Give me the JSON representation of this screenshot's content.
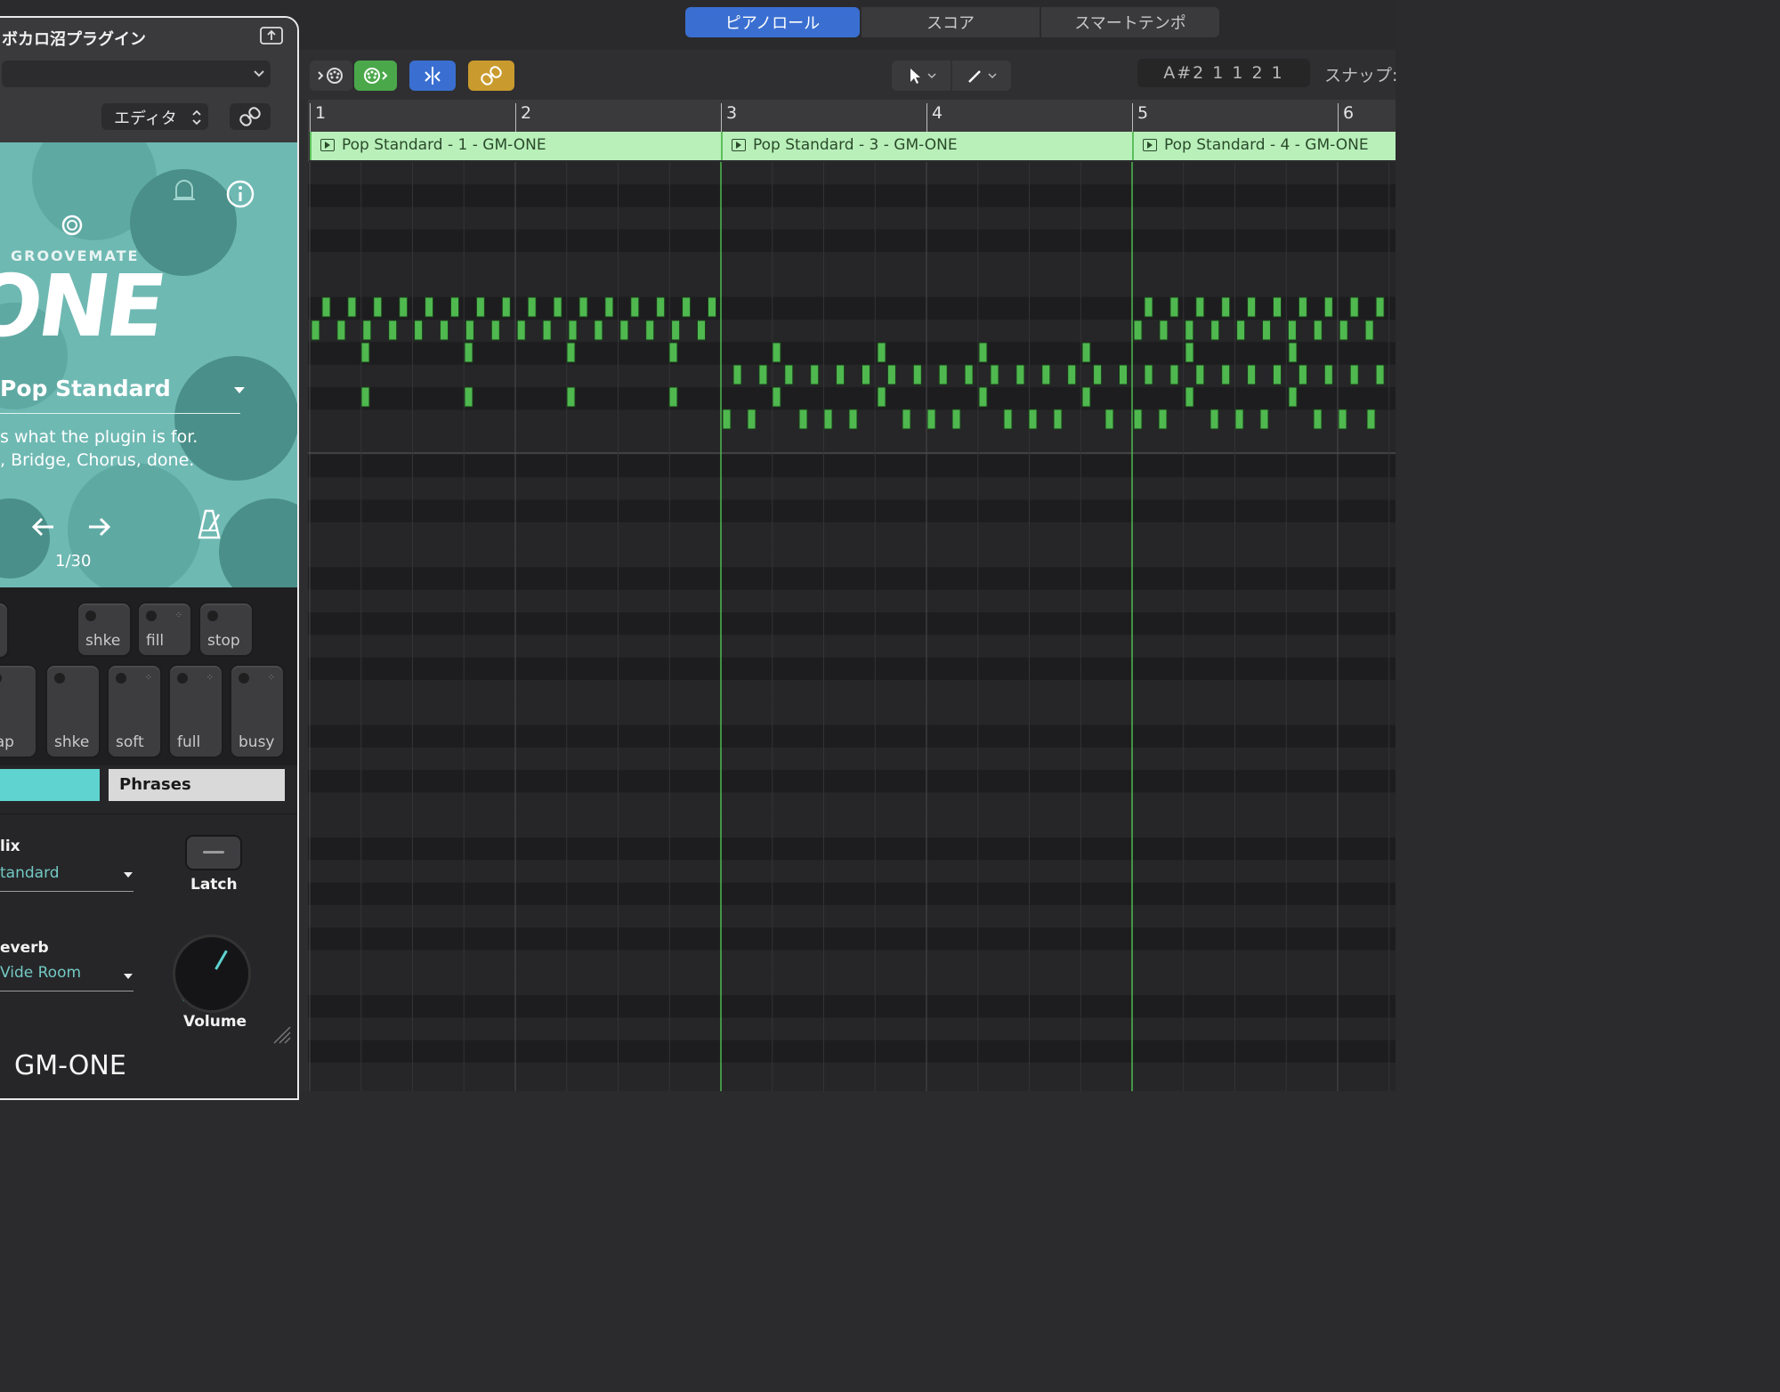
{
  "plugin": {
    "header_title": "ボカロ沼プラグイン",
    "editor_button": "エディタ",
    "brand": "GROOVEMATE",
    "logo_text": "ONE",
    "style_name": "Pop Standard",
    "description_line1": "s what the plugin is for.",
    "description_line2": ", Bridge, Chorus, done.",
    "pager": "1/30",
    "pads_row1": [
      "shke",
      "fill",
      "stop"
    ],
    "pads_row2": [
      "lap",
      "shke",
      "soft",
      "full",
      "busy"
    ],
    "tab_phrases": "Phrases",
    "mix_label": "lix",
    "mix_value": "tandard",
    "latch_label": "Latch",
    "reverb_label": "everb",
    "reverb_value": "Vide Room",
    "volume_label": "Volume",
    "footer_name": "GM-ONE",
    "colors": {
      "teal": "#6fb9b3",
      "tab_accent": "#5ed3cf",
      "value_text": "#73c9c4"
    }
  },
  "topbar": {
    "tabs": [
      {
        "label": "ピアノロール",
        "active": true
      },
      {
        "label": "スコア",
        "active": false
      },
      {
        "label": "スマートテンポ",
        "active": false
      }
    ]
  },
  "toolbar": {
    "lcd": "A#2  1 1 2 1",
    "snap_label": "スナップ:",
    "icons": [
      "midi-in-icon",
      "midi-out-icon",
      "catch-icon",
      "link-icon",
      "pointer-tool-icon",
      "pencil-tool-icon"
    ]
  },
  "ruler": {
    "bars": [
      "1",
      "2",
      "3",
      "4",
      "5",
      "6"
    ]
  },
  "regions": [
    {
      "name": "Pop Standard - 1 - GM-ONE"
    },
    {
      "name": "Pop Standard - 3 - GM-ONE"
    },
    {
      "name": "Pop Standard - 4 - GM-ONE"
    }
  ],
  "colors": {
    "accent": "#3a6fd1",
    "region_fill": "#b9f0ba",
    "note_fill": "#4fb84f",
    "link_button": "#c99a2e",
    "midi_button": "#4aa84a",
    "catch_button": "#3a6fd1"
  }
}
